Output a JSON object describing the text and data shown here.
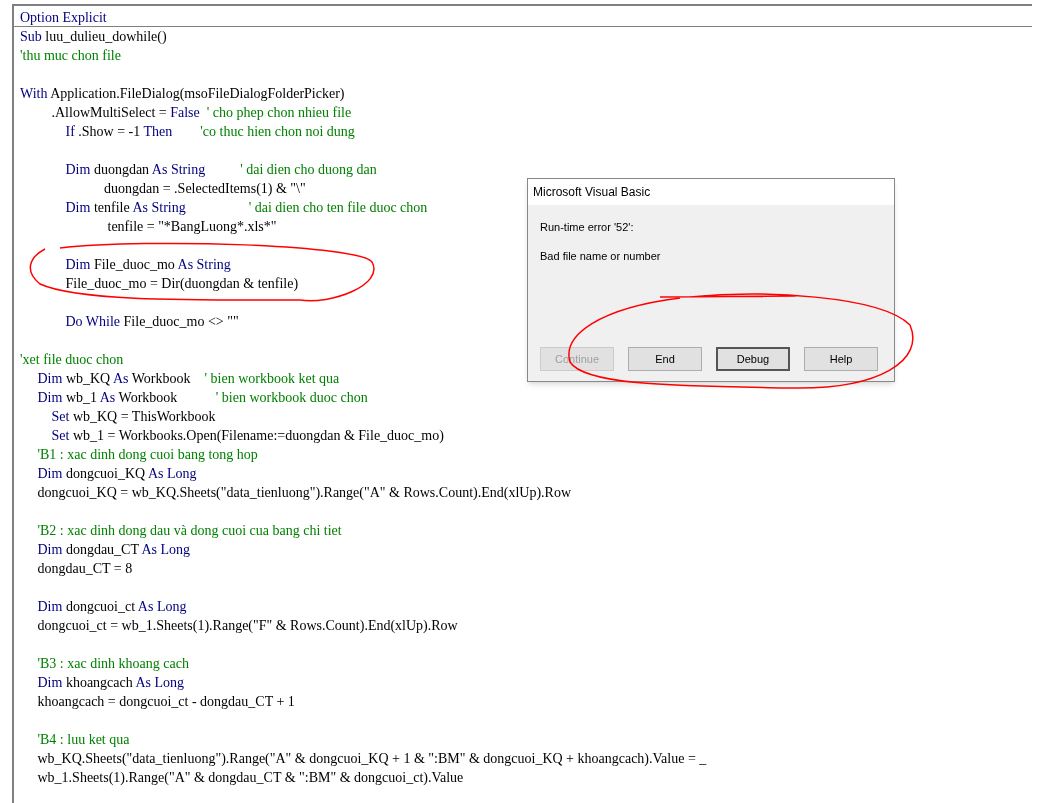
{
  "code": {
    "lines": [
      {
        "kind": "code",
        "separator": true,
        "tokens": [
          {
            "kind": "keyword",
            "text": "Option Explicit"
          }
        ]
      },
      {
        "kind": "code",
        "tokens": [
          {
            "kind": "keyword",
            "text": "Sub "
          },
          {
            "kind": "plain",
            "text": "luu_dulieu_dowhile()"
          }
        ]
      },
      {
        "kind": "code",
        "tokens": [
          {
            "kind": "comment",
            "text": "'thu muc chon file"
          }
        ]
      },
      {
        "kind": "blank"
      },
      {
        "kind": "code",
        "tokens": [
          {
            "kind": "keyword",
            "text": "With "
          },
          {
            "kind": "plain",
            "text": "Application.FileDialog(msoFileDialogFolderPicker)"
          }
        ]
      },
      {
        "kind": "code",
        "tokens": [
          {
            "kind": "plain",
            "text": "         .AllowMultiSelect = "
          },
          {
            "kind": "keyword",
            "text": "False"
          },
          {
            "kind": "comment",
            "text": "  ' cho phep chon nhieu file"
          }
        ]
      },
      {
        "kind": "code",
        "tokens": [
          {
            "kind": "keyword",
            "text": "             If "
          },
          {
            "kind": "plain",
            "text": ".Show = -1 "
          },
          {
            "kind": "keyword",
            "text": "Then"
          },
          {
            "kind": "comment",
            "text": "        'co thuc hien chon noi dung"
          }
        ]
      },
      {
        "kind": "blank"
      },
      {
        "kind": "code",
        "tokens": [
          {
            "kind": "keyword",
            "text": "             Dim "
          },
          {
            "kind": "plain",
            "text": "duongdan "
          },
          {
            "kind": "keyword",
            "text": "As String"
          },
          {
            "kind": "comment",
            "text": "          ' dai dien cho duong dan"
          }
        ]
      },
      {
        "kind": "code",
        "tokens": [
          {
            "kind": "plain",
            "text": "                        duongdan = .SelectedItems(1) & \"\\\""
          }
        ]
      },
      {
        "kind": "code",
        "tokens": [
          {
            "kind": "keyword",
            "text": "             Dim "
          },
          {
            "kind": "plain",
            "text": "tenfile "
          },
          {
            "kind": "keyword",
            "text": "As String"
          },
          {
            "kind": "comment",
            "text": "                  ' dai dien cho ten file duoc chon"
          }
        ]
      },
      {
        "kind": "code",
        "tokens": [
          {
            "kind": "plain",
            "text": "                         tenfile = \"*BangLuong*.xls*\""
          }
        ]
      },
      {
        "kind": "blank"
      },
      {
        "kind": "code",
        "tokens": [
          {
            "kind": "keyword",
            "text": "             Dim "
          },
          {
            "kind": "plain",
            "text": "File_duoc_mo "
          },
          {
            "kind": "keyword",
            "text": "As String"
          }
        ]
      },
      {
        "kind": "code",
        "tokens": [
          {
            "kind": "plain",
            "text": "             File_duoc_mo = Dir(duongdan & tenfile)"
          }
        ]
      },
      {
        "kind": "blank"
      },
      {
        "kind": "code",
        "tokens": [
          {
            "kind": "keyword",
            "text": "             Do While "
          },
          {
            "kind": "plain",
            "text": "File_duoc_mo <> \"\""
          }
        ]
      },
      {
        "kind": "blank"
      },
      {
        "kind": "code",
        "tokens": [
          {
            "kind": "comment",
            "text": "'xet file duoc chon"
          }
        ]
      },
      {
        "kind": "code",
        "tokens": [
          {
            "kind": "keyword",
            "text": "     Dim "
          },
          {
            "kind": "plain",
            "text": "wb_KQ "
          },
          {
            "kind": "keyword",
            "text": "As "
          },
          {
            "kind": "plain",
            "text": "Workbook"
          },
          {
            "kind": "comment",
            "text": "    ' bien workbook ket qua"
          }
        ]
      },
      {
        "kind": "code",
        "tokens": [
          {
            "kind": "keyword",
            "text": "     Dim "
          },
          {
            "kind": "plain",
            "text": "wb_1 "
          },
          {
            "kind": "keyword",
            "text": "As "
          },
          {
            "kind": "plain",
            "text": "Workbook"
          },
          {
            "kind": "comment",
            "text": "           ' bien workbook duoc chon"
          }
        ]
      },
      {
        "kind": "code",
        "tokens": [
          {
            "kind": "keyword",
            "text": "         Set "
          },
          {
            "kind": "plain",
            "text": "wb_KQ = ThisWorkbook"
          }
        ]
      },
      {
        "kind": "code",
        "tokens": [
          {
            "kind": "keyword",
            "text": "         Set "
          },
          {
            "kind": "plain",
            "text": "wb_1 = Workbooks.Open(Filename:=duongdan & File_duoc_mo)"
          }
        ]
      },
      {
        "kind": "code",
        "tokens": [
          {
            "kind": "comment",
            "text": "     'B1 : xac dinh dong cuoi bang tong hop"
          }
        ]
      },
      {
        "kind": "code",
        "tokens": [
          {
            "kind": "keyword",
            "text": "     Dim "
          },
          {
            "kind": "plain",
            "text": "dongcuoi_KQ "
          },
          {
            "kind": "keyword",
            "text": "As Long"
          }
        ]
      },
      {
        "kind": "code",
        "tokens": [
          {
            "kind": "plain",
            "text": "     dongcuoi_KQ = wb_KQ.Sheets(\"data_tienluong\").Range(\"A\" & Rows.Count).End(xlUp).Row"
          }
        ]
      },
      {
        "kind": "blank"
      },
      {
        "kind": "code",
        "tokens": [
          {
            "kind": "comment",
            "text": "     'B2 : xac dinh dong dau và dong cuoi cua bang chi tiet"
          }
        ]
      },
      {
        "kind": "code",
        "tokens": [
          {
            "kind": "keyword",
            "text": "     Dim "
          },
          {
            "kind": "plain",
            "text": "dongdau_CT "
          },
          {
            "kind": "keyword",
            "text": "As Long"
          }
        ]
      },
      {
        "kind": "code",
        "tokens": [
          {
            "kind": "plain",
            "text": "     dongdau_CT = 8"
          }
        ]
      },
      {
        "kind": "blank"
      },
      {
        "kind": "code",
        "tokens": [
          {
            "kind": "keyword",
            "text": "     Dim "
          },
          {
            "kind": "plain",
            "text": "dongcuoi_ct "
          },
          {
            "kind": "keyword",
            "text": "As Long"
          }
        ]
      },
      {
        "kind": "code",
        "tokens": [
          {
            "kind": "plain",
            "text": "     dongcuoi_ct = wb_1.Sheets(1).Range(\"F\" & Rows.Count).End(xlUp).Row"
          }
        ]
      },
      {
        "kind": "blank"
      },
      {
        "kind": "code",
        "tokens": [
          {
            "kind": "comment",
            "text": "     'B3 : xac dinh khoang cach"
          }
        ]
      },
      {
        "kind": "code",
        "tokens": [
          {
            "kind": "keyword",
            "text": "     Dim "
          },
          {
            "kind": "plain",
            "text": "khoangcach "
          },
          {
            "kind": "keyword",
            "text": "As Long"
          }
        ]
      },
      {
        "kind": "code",
        "tokens": [
          {
            "kind": "plain",
            "text": "     khoangcach = dongcuoi_ct - dongdau_CT + 1"
          }
        ]
      },
      {
        "kind": "blank"
      },
      {
        "kind": "code",
        "tokens": [
          {
            "kind": "comment",
            "text": "     'B4 : luu ket qua"
          }
        ]
      },
      {
        "kind": "code",
        "tokens": [
          {
            "kind": "plain",
            "text": "     wb_KQ.Sheets(\"data_tienluong\").Range(\"A\" & dongcuoi_KQ + 1 & \":BM\" & dongcuoi_KQ + khoangcach).Value = _"
          }
        ]
      },
      {
        "kind": "code",
        "tokens": [
          {
            "kind": "plain",
            "text": "     wb_1.Sheets(1).Range(\"A\" & dongdau_CT & \":BM\" & dongcuoi_ct).Value"
          }
        ]
      }
    ]
  },
  "dialog": {
    "title": "Microsoft Visual Basic",
    "error": "Run-time error '52':",
    "message": "Bad file name or number",
    "buttons": [
      {
        "label": "Continue",
        "disabled": true,
        "default": false
      },
      {
        "label": "End",
        "disabled": false,
        "default": false
      },
      {
        "label": "Debug",
        "disabled": false,
        "default": true
      },
      {
        "label": "Help",
        "disabled": false,
        "default": false
      }
    ]
  }
}
